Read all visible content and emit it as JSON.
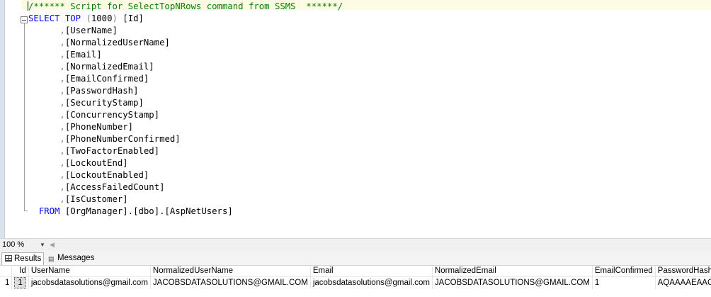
{
  "editor": {
    "comment": "/****** Script for SelectTopNRows command from SSMS  ******/",
    "select_kw": "SELECT",
    "top_kw": "TOP",
    "top_open": "(",
    "top_value": "1000",
    "top_close": ")",
    "first_column": "[Id]",
    "columns": [
      "[UserName]",
      "[NormalizedUserName]",
      "[Email]",
      "[NormalizedEmail]",
      "[EmailConfirmed]",
      "[PasswordHash]",
      "[SecurityStamp]",
      "[ConcurrencyStamp]",
      "[PhoneNumber]",
      "[PhoneNumberConfirmed]",
      "[TwoFactorEnabled]",
      "[LockoutEnd]",
      "[LockoutEnabled]",
      "[AccessFailedCount]",
      "[IsCustomer]"
    ],
    "comma": ",",
    "from_kw": "FROM",
    "from_table": "[OrgManager].[dbo].[AspNetUsers]"
  },
  "statusbar": {
    "zoom": "100 %"
  },
  "tabs": [
    {
      "label": "Results",
      "icon": "grid-icon"
    },
    {
      "label": "Messages",
      "icon": "messages-icon"
    }
  ],
  "results": {
    "headers": [
      "Id",
      "UserName",
      "NormalizedUserName",
      "Email",
      "NormalizedEmail",
      "EmailConfirmed",
      "PasswordHash"
    ],
    "rows": [
      {
        "rownum": "1",
        "cells": [
          "1",
          "jacobsdatasolutions@gmail.com",
          "JACOBSDATASOLUTIONS@GMAIL.COM",
          "jacobsdatasolutions@gmail.com",
          "JACOBSDATASOLUTIONS@GMAIL.COM",
          "1",
          "AQAAAAEAACcQA"
        ]
      }
    ]
  }
}
